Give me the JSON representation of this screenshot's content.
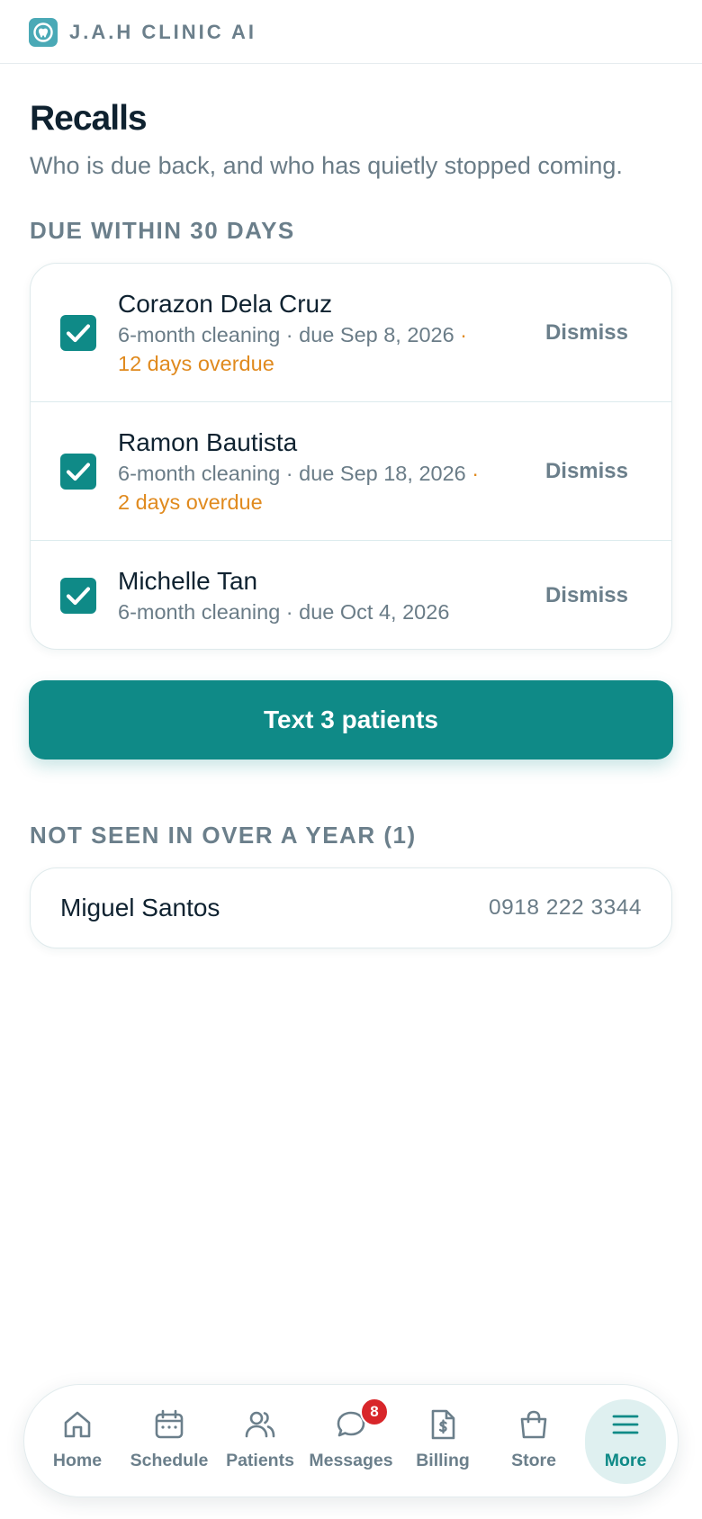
{
  "header": {
    "brand": "J.A.H CLINIC AI",
    "logo_icon": "tooth-logo-icon"
  },
  "page": {
    "title": "Recalls",
    "subtitle": "Who is due back, and who has quietly stopped coming."
  },
  "due_section": {
    "heading": "DUE WITHIN 30 DAYS",
    "items": [
      {
        "name": "Corazon Dela Cruz",
        "detail": "6-month cleaning · due Sep 8, 2026",
        "separator": " ·",
        "overdue": "12 days overdue",
        "checked": true,
        "dismiss_label": "Dismiss"
      },
      {
        "name": "Ramon Bautista",
        "detail": "6-month cleaning · due Sep 18, 2026",
        "separator": " ·",
        "overdue": "2 days overdue",
        "checked": true,
        "dismiss_label": "Dismiss"
      },
      {
        "name": "Michelle Tan",
        "detail": "6-month cleaning · due Oct 4, 2026",
        "checked": true,
        "dismiss_label": "Dismiss"
      }
    ],
    "action_label": "Text 3 patients"
  },
  "lapsed_section": {
    "heading": "NOT SEEN IN OVER A YEAR (1)",
    "items": [
      {
        "name": "Miguel Santos",
        "phone": "0918 222 3344"
      }
    ]
  },
  "bottom_nav": {
    "items": [
      {
        "label": "Home",
        "icon": "home-icon"
      },
      {
        "label": "Schedule",
        "icon": "calendar-icon"
      },
      {
        "label": "Patients",
        "icon": "users-icon"
      },
      {
        "label": "Messages",
        "icon": "chat-icon",
        "badge": "8"
      },
      {
        "label": "Billing",
        "icon": "invoice-icon"
      },
      {
        "label": "Store",
        "icon": "shopping-bag-icon"
      },
      {
        "label": "More",
        "icon": "menu-icon",
        "active": true
      }
    ]
  },
  "colors": {
    "accent": "#0f8a87",
    "overdue": "#e08a1e",
    "badge": "#d8262a",
    "muted": "#6b7f8b"
  }
}
